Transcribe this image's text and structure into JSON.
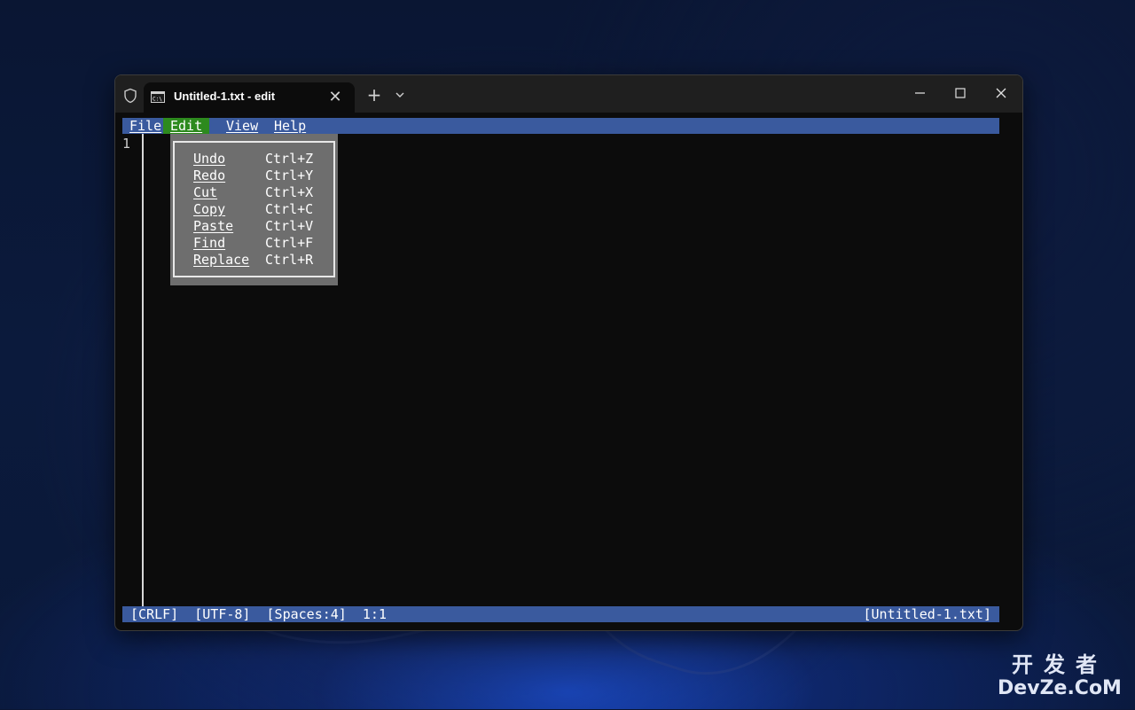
{
  "window": {
    "tab_title": "Untitled-1.txt - edit",
    "tab_icon": "cmd-icon"
  },
  "menubar": {
    "items": [
      "File",
      "Edit",
      "View",
      "Help"
    ],
    "active": "Edit"
  },
  "editor": {
    "line_number": "1"
  },
  "edit_menu": {
    "items": [
      {
        "label": "Undo",
        "shortcut": "Ctrl+Z"
      },
      {
        "label": "Redo",
        "shortcut": "Ctrl+Y"
      },
      {
        "label": "Cut",
        "shortcut": "Ctrl+X"
      },
      {
        "label": "Copy",
        "shortcut": "Ctrl+C"
      },
      {
        "label": "Paste",
        "shortcut": "Ctrl+V"
      },
      {
        "label": "Find",
        "shortcut": "Ctrl+F"
      },
      {
        "label": "Replace",
        "shortcut": "Ctrl+R"
      }
    ]
  },
  "statusbar": {
    "left": "[CRLF]  [UTF-8]  [Spaces:4]  1:1",
    "right": "[Untitled-1.txt]"
  },
  "watermark": {
    "line1": "开发者",
    "line2": "DevZe.CoM"
  },
  "colors": {
    "menubar_bg": "#3a5a9e",
    "active_menu_bg": "#2d8a1e",
    "dropdown_bg": "#6e6e6e",
    "terminal_bg": "#0c0c0c"
  }
}
